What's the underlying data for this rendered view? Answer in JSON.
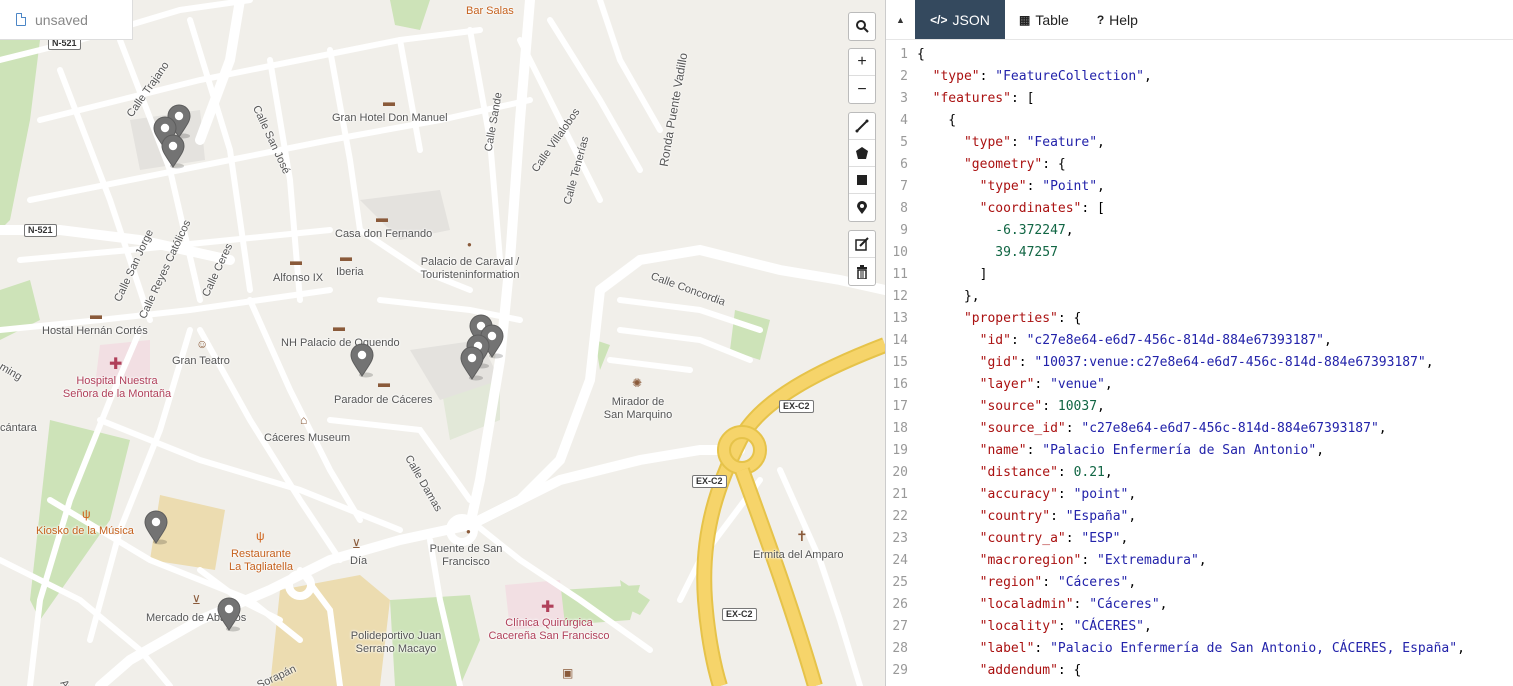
{
  "file": {
    "status": "unsaved",
    "icon": "file-icon"
  },
  "map": {
    "streets": [
      {
        "text": "Bar Salas",
        "cls": "orange"
      },
      {
        "text": "Calle Trajano"
      },
      {
        "text": "Calle San José"
      },
      {
        "text": "Gran Hotel Don Manuel"
      },
      {
        "text": "Calle Sande"
      },
      {
        "text": "Calle Villalobos"
      },
      {
        "text": "Calle Tenerías"
      },
      {
        "text": "Ronda Puente Vadillo"
      },
      {
        "text": "Casa don Fernando"
      },
      {
        "text": "Palacio de Caraval /\nTouristeninformation"
      },
      {
        "text": "Iberia"
      },
      {
        "text": "Alfonso IX"
      },
      {
        "text": "Calle San Jorge"
      },
      {
        "text": "Calle Reyes Católicos"
      },
      {
        "text": "Calle Ceres"
      },
      {
        "text": "Calle Concordia"
      },
      {
        "text": "Hostal Hernán Cortés"
      },
      {
        "text": "NH Palacio de Oquendo"
      },
      {
        "text": "Gran Teatro"
      },
      {
        "text": "Hospital Nuestra\nSeñora de la Montaña",
        "cls": "pink"
      },
      {
        "text": "Parador de Cáceres"
      },
      {
        "text": "Mirador de\nSan Marquino"
      },
      {
        "text": "Cáceres Museum"
      },
      {
        "text": "Calle Damas"
      },
      {
        "text": "Kiosko de la Música",
        "cls": "orange"
      },
      {
        "text": "Restaurante\nLa Tagliatella",
        "cls": "orange"
      },
      {
        "text": "Día"
      },
      {
        "text": "Puente de San\nFrancisco"
      },
      {
        "text": "Ermita del Amparo"
      },
      {
        "text": "Mercado de Abastos"
      },
      {
        "text": "Polideportivo Juan\nSerrano Macayo"
      },
      {
        "text": "Clínica Quirúrgica\nCacereña San Francisco",
        "cls": "pink"
      },
      {
        "text": "ming"
      },
      {
        "text": "cántara"
      },
      {
        "text": "Sorapán"
      },
      {
        "text": "Ave"
      }
    ],
    "shields": [
      "N-521",
      "N-521",
      "EX-C2",
      "EX-C2",
      "EX-C2"
    ],
    "markers": [
      {
        "name": "venue-marker"
      },
      {
        "name": "venue-marker"
      },
      {
        "name": "venue-marker"
      },
      {
        "name": "venue-marker"
      },
      {
        "name": "venue-marker"
      },
      {
        "name": "venue-marker"
      },
      {
        "name": "venue-marker"
      },
      {
        "name": "venue-marker"
      },
      {
        "name": "venue-marker"
      },
      {
        "name": "venue-marker"
      }
    ],
    "controls": {
      "search": "search-icon",
      "zoom_in": "+",
      "zoom_out": "−",
      "draw": [
        "draw-line-icon",
        "draw-polygon-icon",
        "draw-rectangle-icon",
        "draw-marker-icon"
      ],
      "edit": [
        "edit-icon",
        "trash-icon"
      ]
    }
  },
  "panel": {
    "collapse": "▲",
    "tabs": [
      {
        "label": "JSON",
        "icon": "</>",
        "active": true
      },
      {
        "label": "Table",
        "icon": "▦",
        "active": false
      },
      {
        "label": "Help",
        "icon": "?",
        "active": false
      }
    ],
    "code_lines": [
      [
        [
          "{",
          "p"
        ]
      ],
      [
        [
          "  ",
          "p"
        ],
        [
          "\"type\"",
          "k"
        ],
        [
          ": ",
          "p"
        ],
        [
          "\"FeatureCollection\"",
          "s"
        ],
        [
          ",",
          "p"
        ]
      ],
      [
        [
          "  ",
          "p"
        ],
        [
          "\"features\"",
          "k"
        ],
        [
          ": [",
          "p"
        ]
      ],
      [
        [
          "    {",
          "p"
        ]
      ],
      [
        [
          "      ",
          "p"
        ],
        [
          "\"type\"",
          "k"
        ],
        [
          ": ",
          "p"
        ],
        [
          "\"Feature\"",
          "s"
        ],
        [
          ",",
          "p"
        ]
      ],
      [
        [
          "      ",
          "p"
        ],
        [
          "\"geometry\"",
          "k"
        ],
        [
          ": {",
          "p"
        ]
      ],
      [
        [
          "        ",
          "p"
        ],
        [
          "\"type\"",
          "k"
        ],
        [
          ": ",
          "p"
        ],
        [
          "\"Point\"",
          "s"
        ],
        [
          ",",
          "p"
        ]
      ],
      [
        [
          "        ",
          "p"
        ],
        [
          "\"coordinates\"",
          "k"
        ],
        [
          ": [",
          "p"
        ]
      ],
      [
        [
          "          ",
          "p"
        ],
        [
          "-6.372247",
          "n"
        ],
        [
          ",",
          "p"
        ]
      ],
      [
        [
          "          ",
          "p"
        ],
        [
          "39.47257",
          "n"
        ]
      ],
      [
        [
          "        ]",
          "p"
        ]
      ],
      [
        [
          "      },",
          "p"
        ]
      ],
      [
        [
          "      ",
          "p"
        ],
        [
          "\"properties\"",
          "k"
        ],
        [
          ": {",
          "p"
        ]
      ],
      [
        [
          "        ",
          "p"
        ],
        [
          "\"id\"",
          "k"
        ],
        [
          ": ",
          "p"
        ],
        [
          "\"c27e8e64-e6d7-456c-814d-884e67393187\"",
          "s"
        ],
        [
          ",",
          "p"
        ]
      ],
      [
        [
          "        ",
          "p"
        ],
        [
          "\"gid\"",
          "k"
        ],
        [
          ": ",
          "p"
        ],
        [
          "\"10037:venue:c27e8e64-e6d7-456c-814d-884e67393187\"",
          "s"
        ],
        [
          ",",
          "p"
        ]
      ],
      [
        [
          "        ",
          "p"
        ],
        [
          "\"layer\"",
          "k"
        ],
        [
          ": ",
          "p"
        ],
        [
          "\"venue\"",
          "s"
        ],
        [
          ",",
          "p"
        ]
      ],
      [
        [
          "        ",
          "p"
        ],
        [
          "\"source\"",
          "k"
        ],
        [
          ": ",
          "p"
        ],
        [
          "10037",
          "n"
        ],
        [
          ",",
          "p"
        ]
      ],
      [
        [
          "        ",
          "p"
        ],
        [
          "\"source_id\"",
          "k"
        ],
        [
          ": ",
          "p"
        ],
        [
          "\"c27e8e64-e6d7-456c-814d-884e67393187\"",
          "s"
        ],
        [
          ",",
          "p"
        ]
      ],
      [
        [
          "        ",
          "p"
        ],
        [
          "\"name\"",
          "k"
        ],
        [
          ": ",
          "p"
        ],
        [
          "\"Palacio Enfermería de San Antonio\"",
          "s"
        ],
        [
          ",",
          "p"
        ]
      ],
      [
        [
          "        ",
          "p"
        ],
        [
          "\"distance\"",
          "k"
        ],
        [
          ": ",
          "p"
        ],
        [
          "0.21",
          "n"
        ],
        [
          ",",
          "p"
        ]
      ],
      [
        [
          "        ",
          "p"
        ],
        [
          "\"accuracy\"",
          "k"
        ],
        [
          ": ",
          "p"
        ],
        [
          "\"point\"",
          "s"
        ],
        [
          ",",
          "p"
        ]
      ],
      [
        [
          "        ",
          "p"
        ],
        [
          "\"country\"",
          "k"
        ],
        [
          ": ",
          "p"
        ],
        [
          "\"España\"",
          "s"
        ],
        [
          ",",
          "p"
        ]
      ],
      [
        [
          "        ",
          "p"
        ],
        [
          "\"country_a\"",
          "k"
        ],
        [
          ": ",
          "p"
        ],
        [
          "\"ESP\"",
          "s"
        ],
        [
          ",",
          "p"
        ]
      ],
      [
        [
          "        ",
          "p"
        ],
        [
          "\"macroregion\"",
          "k"
        ],
        [
          ": ",
          "p"
        ],
        [
          "\"Extremadura\"",
          "s"
        ],
        [
          ",",
          "p"
        ]
      ],
      [
        [
          "        ",
          "p"
        ],
        [
          "\"region\"",
          "k"
        ],
        [
          ": ",
          "p"
        ],
        [
          "\"Cáceres\"",
          "s"
        ],
        [
          ",",
          "p"
        ]
      ],
      [
        [
          "        ",
          "p"
        ],
        [
          "\"localadmin\"",
          "k"
        ],
        [
          ": ",
          "p"
        ],
        [
          "\"Cáceres\"",
          "s"
        ],
        [
          ",",
          "p"
        ]
      ],
      [
        [
          "        ",
          "p"
        ],
        [
          "\"locality\"",
          "k"
        ],
        [
          ": ",
          "p"
        ],
        [
          "\"CÁCERES\"",
          "s"
        ],
        [
          ",",
          "p"
        ]
      ],
      [
        [
          "        ",
          "p"
        ],
        [
          "\"label\"",
          "k"
        ],
        [
          ": ",
          "p"
        ],
        [
          "\"Palacio Enfermería de San Antonio, CÁCERES, España\"",
          "s"
        ],
        [
          ",",
          "p"
        ]
      ],
      [
        [
          "        ",
          "p"
        ],
        [
          "\"addendum\"",
          "k"
        ],
        [
          ": {",
          "p"
        ]
      ]
    ]
  }
}
